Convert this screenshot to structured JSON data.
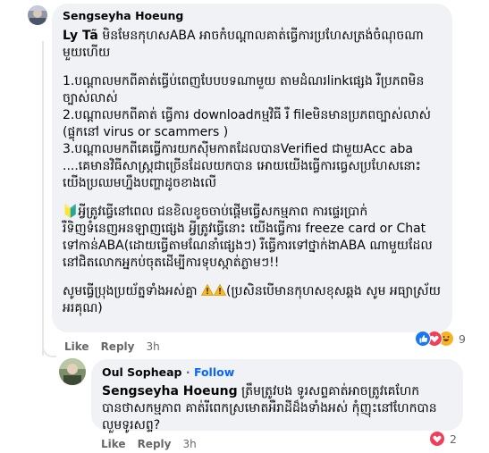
{
  "comment1": {
    "author": "Sengseyha Hoeung",
    "mention": "Ly Tã",
    "intro": "មិនមែនកុហសABA អាចកំបណ្តាលគាត់ធ្វើការប្រហែសត្រង់ចំណុចណា មួយហើយ",
    "point1": "1.បណ្តាលមកពីគាត់ធ្វើប់ពេញបែបបទណាមួយ តាមដំណរlinkផ្សេង រឺប្រភពមិនច្បាស់លាស់",
    "point2": "2.បណ្តាលមកពីគាត់ ធ្វើការ downloadកម្មវិធី រឺ fileមិនមានប្រភពច្បាស់លាស់ (ផ្ទុកនៅ virus or scammers )",
    "point3": "3.បណ្តាលមកពីគេធ្វើការយកស៊ីមកាតដែលបានVerified ជាមួយAcc aba ....គេមានវិធីសាស្រ្តជាច្រើនដែលយកបាន អោយយើងធ្វើការធ្វេសប្រហែសនោះយើងប្រឈមហ្នឹងបញ្ហាដូចខាងលើ",
    "advice": "🔰អ្វីត្រូវធ្វើនៅពេល ជនខិលខូចចាប់ផ្តើមធ្វើសកម្មភាព ការផ្ទេរប្រាក់ រឺទិញទំនេញអនឡាញផ្សេង អ្វីត្រូវធ្វើនោះ យើងធ្វើការ freeze card or Chat ទៅកាន់ABA(ដោយធ្វើតាមណែនាំផ្សេងៗ) រឺធ្វើការទៅថ្នាក់ងាABA ណាមួយដែលនៅជិតលោកអ្នកប់ចុតដើម្បីការទុបស្កាត់ភ្លាមៗ!!",
    "closing_text": "សូមធ្វើប្រុងប្រយ័ត្នទាំងអស់គ្នា",
    "closing_note": "(ប្រសិនបើមានកុហសខុសឆ្គង សូម អធ្យាស្រ័យ អរគុណ)",
    "like_label": "Like",
    "reply_label": "Reply",
    "time": "3h",
    "reaction_count": "9",
    "react_colors": {
      "like": "#1877f2",
      "love": "#f33e58",
      "haha": "#f7b125"
    }
  },
  "comment2": {
    "author": "Oul Sopheap",
    "separator": "·",
    "follow_label": "Follow",
    "mention": "Sengseyha Hoeung",
    "text": "ត្រឹមត្រូវបង ទូរសព្ទគាត់អាចត្រូវគេហែក បានថាសកម្មភាព គាត់រីពេកស្រមោតអឺរាដីដ៏ងទាំងអស់ កុំញុះនៅហែកបាន លួមទូរសព្ទ?",
    "like_label": "Like",
    "reply_label": "Reply",
    "time": "3h",
    "reaction_count": "2",
    "react_colors": {
      "love": "#f33e58"
    }
  }
}
